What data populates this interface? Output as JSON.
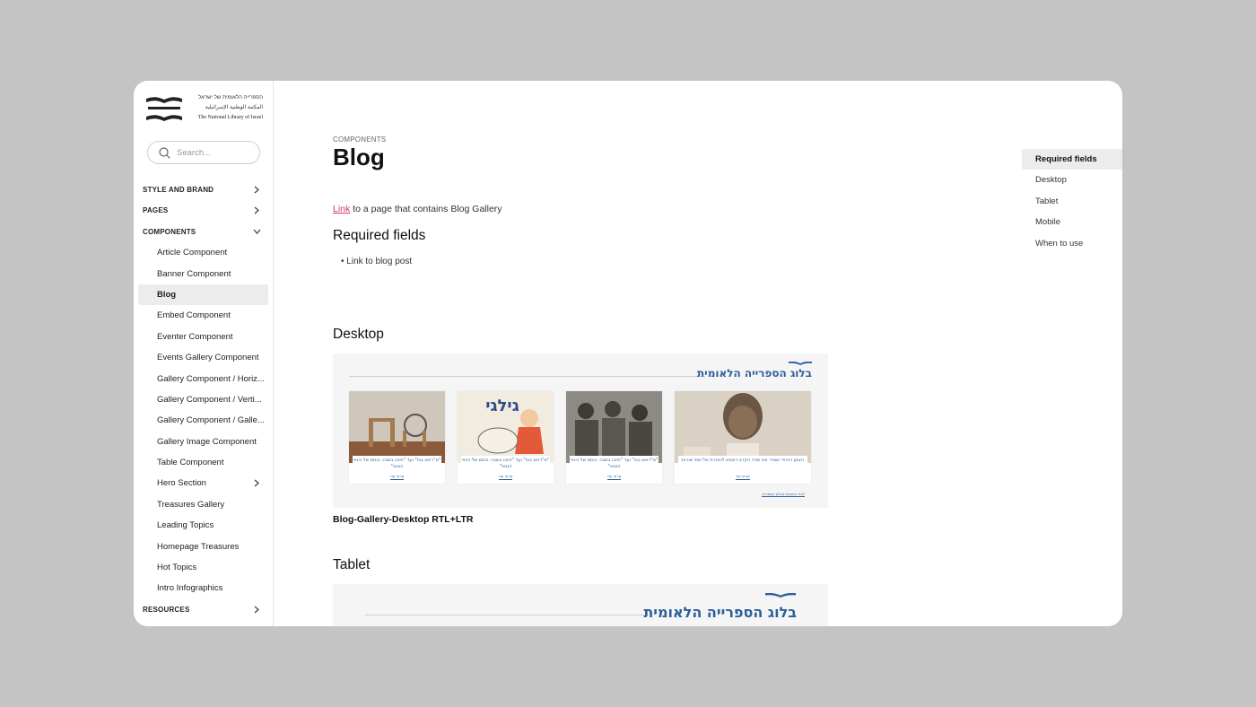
{
  "logo": {
    "line_he": "הספרייה הלאומית של ישראל",
    "line_ar": "المكتبة الوطنية الإسرائيلية",
    "line_en": "The National Library of Israel"
  },
  "search": {
    "placeholder": "Search..."
  },
  "nav": [
    {
      "label": "STYLE AND BRAND",
      "type": "section",
      "chevron": "right"
    },
    {
      "label": "PAGES",
      "type": "section",
      "chevron": "right"
    },
    {
      "label": "COMPONENTS",
      "type": "section",
      "chevron": "down"
    },
    {
      "label": "Article Component",
      "type": "item"
    },
    {
      "label": "Banner Component",
      "type": "item"
    },
    {
      "label": "Blog",
      "type": "item",
      "active": true
    },
    {
      "label": "Embed Component",
      "type": "item"
    },
    {
      "label": "Eventer Component",
      "type": "item"
    },
    {
      "label": "Events Gallery Component",
      "type": "item"
    },
    {
      "label": "Gallery Component / Horiz...",
      "type": "item"
    },
    {
      "label": "Gallery Component / Verti...",
      "type": "item"
    },
    {
      "label": "Gallery Component / Galle...",
      "type": "item"
    },
    {
      "label": "Gallery Image Component",
      "type": "item"
    },
    {
      "label": "Table Component",
      "type": "item"
    },
    {
      "label": "Hero Section",
      "type": "item",
      "chevron": "right"
    },
    {
      "label": "Treasures Gallery",
      "type": "item"
    },
    {
      "label": "Leading Topics",
      "type": "item"
    },
    {
      "label": "Homepage Treasures",
      "type": "item"
    },
    {
      "label": "Hot Topics",
      "type": "item"
    },
    {
      "label": "Intro Infographics",
      "type": "item"
    },
    {
      "label": "RESOURCES",
      "type": "section",
      "chevron": "right"
    }
  ],
  "main": {
    "eyebrow": "COMPONENTS",
    "title": "Blog",
    "intro_link": "Link",
    "intro_rest": " to a page that contains Blog Gallery",
    "required_heading": "Required fields",
    "bullet": "• Link to blog post",
    "desktop_heading": "Desktop",
    "desktop_caption": "Blog-Gallery-Desktop RTL+LTR",
    "tablet_heading": "Tablet"
  },
  "blog_preview": {
    "heading": "בלוג הספרייה הלאומית",
    "all_link": "לכל הכתבות בבלוג הספרייה",
    "read_more": "קראו עוד",
    "cards": [
      {
        "caption": "האמן היהודי שצייר את שדה הקרב דוגמא לכותרת של שתי שורות"
      },
      {
        "caption": "\"מ\"ראש גנוז\" ועד \"חיוכו בשנה: כותם של כינויי הנגאי\""
      },
      {
        "caption": "\"מ\"ראש גנוז\" ועד \"חיוכו בשנה: כותם של כינויי הנגאי\""
      },
      {
        "caption": "\"מ\"ראש גנוז\" ועד \"חיוכו בשנה: כותם של כינויי הנגאי\""
      }
    ],
    "card_title_art": "גילגי"
  },
  "toc": [
    {
      "label": "Required fields",
      "active": true
    },
    {
      "label": "Desktop"
    },
    {
      "label": "Tablet"
    },
    {
      "label": "Mobile"
    },
    {
      "label": "When to use"
    }
  ],
  "colors": {
    "accent_link": "#d6336c",
    "blog_blue": "#2e5f9a",
    "active_bg": "#ececec",
    "backdrop": "#c4c4c4"
  }
}
